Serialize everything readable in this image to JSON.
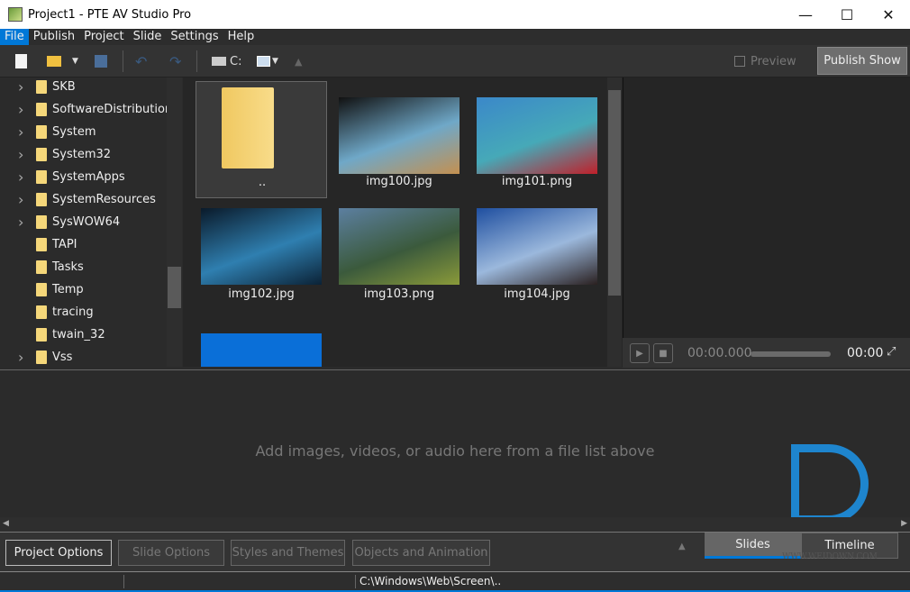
{
  "window": {
    "title": "Project1 - PTE AV Studio Pro",
    "minimize": "—",
    "maximize": "☐",
    "close": "✕"
  },
  "menu": [
    "File",
    "Publish",
    "Project",
    "Slide",
    "Settings",
    "Help"
  ],
  "toolbar": {
    "drive_label": "C:",
    "preview_label": "Preview",
    "publish_label": "Publish Show"
  },
  "tree": [
    {
      "name": "SKB",
      "expandable": true
    },
    {
      "name": "SoftwareDistribution",
      "expandable": true
    },
    {
      "name": "System",
      "expandable": true
    },
    {
      "name": "System32",
      "expandable": true
    },
    {
      "name": "SystemApps",
      "expandable": true
    },
    {
      "name": "SystemResources",
      "expandable": true
    },
    {
      "name": "SysWOW64",
      "expandable": true
    },
    {
      "name": "TAPI",
      "expandable": false
    },
    {
      "name": "Tasks",
      "expandable": false
    },
    {
      "name": "Temp",
      "expandable": false
    },
    {
      "name": "tracing",
      "expandable": false
    },
    {
      "name": "twain_32",
      "expandable": false
    },
    {
      "name": "Vss",
      "expandable": true
    }
  ],
  "files": [
    {
      "name": "..",
      "type": "folder"
    },
    {
      "name": "img100.jpg",
      "colors": [
        "#111",
        "#6fa8c8",
        "#c49050"
      ]
    },
    {
      "name": "img101.png",
      "colors": [
        "#3b88c9",
        "#46a9b8",
        "#c0202a"
      ]
    },
    {
      "name": "img102.jpg",
      "colors": [
        "#0a1a2a",
        "#2f7fb0",
        "#0b2236"
      ]
    },
    {
      "name": "img103.png",
      "colors": [
        "#5c7fa0",
        "#3b5a3c",
        "#8a9a3a"
      ]
    },
    {
      "name": "img104.jpg",
      "colors": [
        "#1f4fa0",
        "#9bb8dc",
        "#2a2020"
      ]
    },
    {
      "name": "",
      "colors": [
        "#0a6fd8",
        "#0a6fd8",
        "#0a6fd8"
      ]
    }
  ],
  "player": {
    "current_time": "00:00.000",
    "end_time": "00:00",
    "progress": 0
  },
  "slides": {
    "placeholder": "Add images, videos, or audio here from a file list above"
  },
  "bottom": {
    "project_options": "Project Options",
    "slide_options": "Slide Options",
    "styles_themes": "Styles and Themes",
    "objects_animation": "Objects and Animation",
    "tab_slides": "Slides",
    "tab_timeline": "Timeline"
  },
  "status": {
    "path": "C:\\Windows\\Web\\Screen\\.."
  },
  "watermark": {
    "text": "WWW.WEIDOWN.COM"
  },
  "colors": {
    "accent": "#0078d7",
    "folder": "#f5d77a"
  }
}
